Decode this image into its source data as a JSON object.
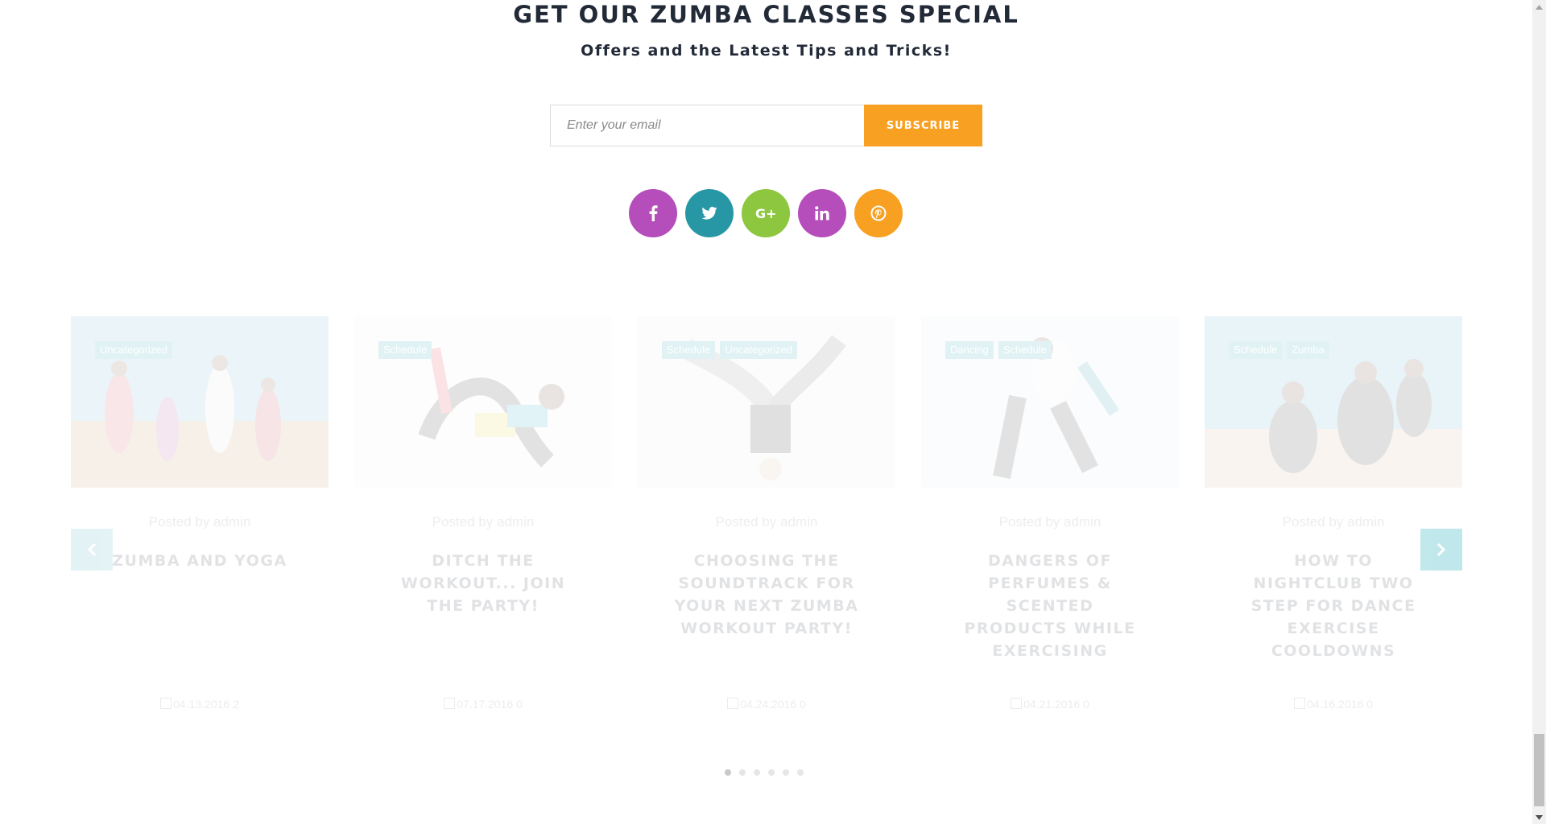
{
  "newsletter": {
    "title": "GET OUR ZUMBA CLASSES SPECIAL",
    "subtitle": "Offers and the Latest Tips and Tricks!",
    "email_placeholder": "Enter your email",
    "subscribe_label": "SUBSCRIBE",
    "accent_color": "#f7a022"
  },
  "social": [
    {
      "name": "facebook",
      "icon": "facebook-icon",
      "color": "#b54dba"
    },
    {
      "name": "twitter",
      "icon": "twitter-icon",
      "color": "#2797a6"
    },
    {
      "name": "google-plus",
      "icon": "google-plus-icon",
      "color": "#8dc63f"
    },
    {
      "name": "linkedin",
      "icon": "linkedin-icon",
      "color": "#b54dba"
    },
    {
      "name": "pinterest",
      "icon": "pinterest-icon",
      "color": "#f7a022"
    }
  ],
  "carousel": {
    "posts": [
      {
        "tags": [
          "Uncategorized"
        ],
        "meta": "Posted by admin",
        "title": "ZUMBA AND YOGA",
        "date": "04.13.2016 2"
      },
      {
        "tags": [
          "Schedule"
        ],
        "meta": "Posted by admin",
        "title": "DITCH THE WORKOUT... JOIN THE PARTY!",
        "date": "07.17.2016 0"
      },
      {
        "tags": [
          "Schedule",
          "Uncategorized"
        ],
        "meta": "Posted by admin",
        "title": "CHOOSING THE SOUNDTRACK FOR YOUR NEXT ZUMBA WORKOUT PARTY!",
        "date": "04.24.2016 0"
      },
      {
        "tags": [
          "Dancing",
          "Schedule"
        ],
        "meta": "Posted by admin",
        "title": "DANGERS OF PERFUMES & SCENTED PRODUCTS WHILE EXERCISING",
        "date": "04.21.2016 0"
      },
      {
        "tags": [
          "Schedule",
          "Zumba"
        ],
        "meta": "Posted by admin",
        "title": "HOW TO NIGHTCLUB TWO STEP FOR DANCE EXERCISE COOLDOWNS",
        "date": "04.16.2016 0"
      }
    ],
    "page_count": 6,
    "active_page": 1,
    "tag_color": "#1fa3b0"
  }
}
